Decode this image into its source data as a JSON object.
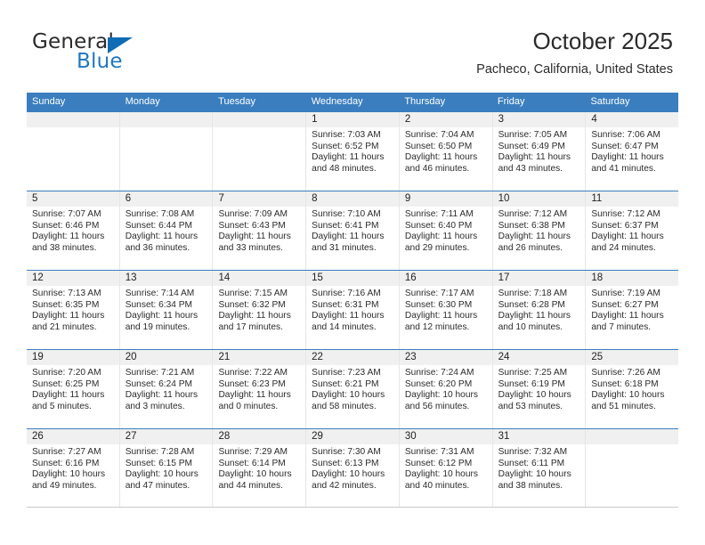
{
  "brand": {
    "name_top": "General",
    "name_bottom": "Blue",
    "accent_color": "#0f6cb5"
  },
  "header": {
    "title": "October 2025",
    "subtitle": "Pacheco, California, United States"
  },
  "calendar": {
    "header_color": "#3a7ebf",
    "weekdays": [
      "Sunday",
      "Monday",
      "Tuesday",
      "Wednesday",
      "Thursday",
      "Friday",
      "Saturday"
    ],
    "labels": {
      "sunrise": "Sunrise:",
      "sunset": "Sunset:",
      "daylight": "Daylight:"
    },
    "weeks": [
      [
        {
          "date": "",
          "empty": true
        },
        {
          "date": "",
          "empty": true
        },
        {
          "date": "",
          "empty": true
        },
        {
          "date": "1",
          "sunrise": "Sunrise: 7:03 AM",
          "sunset": "Sunset: 6:52 PM",
          "daylight": "Daylight: 11 hours and 48 minutes."
        },
        {
          "date": "2",
          "sunrise": "Sunrise: 7:04 AM",
          "sunset": "Sunset: 6:50 PM",
          "daylight": "Daylight: 11 hours and 46 minutes."
        },
        {
          "date": "3",
          "sunrise": "Sunrise: 7:05 AM",
          "sunset": "Sunset: 6:49 PM",
          "daylight": "Daylight: 11 hours and 43 minutes."
        },
        {
          "date": "4",
          "sunrise": "Sunrise: 7:06 AM",
          "sunset": "Sunset: 6:47 PM",
          "daylight": "Daylight: 11 hours and 41 minutes."
        }
      ],
      [
        {
          "date": "5",
          "sunrise": "Sunrise: 7:07 AM",
          "sunset": "Sunset: 6:46 PM",
          "daylight": "Daylight: 11 hours and 38 minutes."
        },
        {
          "date": "6",
          "sunrise": "Sunrise: 7:08 AM",
          "sunset": "Sunset: 6:44 PM",
          "daylight": "Daylight: 11 hours and 36 minutes."
        },
        {
          "date": "7",
          "sunrise": "Sunrise: 7:09 AM",
          "sunset": "Sunset: 6:43 PM",
          "daylight": "Daylight: 11 hours and 33 minutes."
        },
        {
          "date": "8",
          "sunrise": "Sunrise: 7:10 AM",
          "sunset": "Sunset: 6:41 PM",
          "daylight": "Daylight: 11 hours and 31 minutes."
        },
        {
          "date": "9",
          "sunrise": "Sunrise: 7:11 AM",
          "sunset": "Sunset: 6:40 PM",
          "daylight": "Daylight: 11 hours and 29 minutes."
        },
        {
          "date": "10",
          "sunrise": "Sunrise: 7:12 AM",
          "sunset": "Sunset: 6:38 PM",
          "daylight": "Daylight: 11 hours and 26 minutes."
        },
        {
          "date": "11",
          "sunrise": "Sunrise: 7:12 AM",
          "sunset": "Sunset: 6:37 PM",
          "daylight": "Daylight: 11 hours and 24 minutes."
        }
      ],
      [
        {
          "date": "12",
          "sunrise": "Sunrise: 7:13 AM",
          "sunset": "Sunset: 6:35 PM",
          "daylight": "Daylight: 11 hours and 21 minutes."
        },
        {
          "date": "13",
          "sunrise": "Sunrise: 7:14 AM",
          "sunset": "Sunset: 6:34 PM",
          "daylight": "Daylight: 11 hours and 19 minutes."
        },
        {
          "date": "14",
          "sunrise": "Sunrise: 7:15 AM",
          "sunset": "Sunset: 6:32 PM",
          "daylight": "Daylight: 11 hours and 17 minutes."
        },
        {
          "date": "15",
          "sunrise": "Sunrise: 7:16 AM",
          "sunset": "Sunset: 6:31 PM",
          "daylight": "Daylight: 11 hours and 14 minutes."
        },
        {
          "date": "16",
          "sunrise": "Sunrise: 7:17 AM",
          "sunset": "Sunset: 6:30 PM",
          "daylight": "Daylight: 11 hours and 12 minutes."
        },
        {
          "date": "17",
          "sunrise": "Sunrise: 7:18 AM",
          "sunset": "Sunset: 6:28 PM",
          "daylight": "Daylight: 11 hours and 10 minutes."
        },
        {
          "date": "18",
          "sunrise": "Sunrise: 7:19 AM",
          "sunset": "Sunset: 6:27 PM",
          "daylight": "Daylight: 11 hours and 7 minutes."
        }
      ],
      [
        {
          "date": "19",
          "sunrise": "Sunrise: 7:20 AM",
          "sunset": "Sunset: 6:25 PM",
          "daylight": "Daylight: 11 hours and 5 minutes."
        },
        {
          "date": "20",
          "sunrise": "Sunrise: 7:21 AM",
          "sunset": "Sunset: 6:24 PM",
          "daylight": "Daylight: 11 hours and 3 minutes."
        },
        {
          "date": "21",
          "sunrise": "Sunrise: 7:22 AM",
          "sunset": "Sunset: 6:23 PM",
          "daylight": "Daylight: 11 hours and 0 minutes."
        },
        {
          "date": "22",
          "sunrise": "Sunrise: 7:23 AM",
          "sunset": "Sunset: 6:21 PM",
          "daylight": "Daylight: 10 hours and 58 minutes."
        },
        {
          "date": "23",
          "sunrise": "Sunrise: 7:24 AM",
          "sunset": "Sunset: 6:20 PM",
          "daylight": "Daylight: 10 hours and 56 minutes."
        },
        {
          "date": "24",
          "sunrise": "Sunrise: 7:25 AM",
          "sunset": "Sunset: 6:19 PM",
          "daylight": "Daylight: 10 hours and 53 minutes."
        },
        {
          "date": "25",
          "sunrise": "Sunrise: 7:26 AM",
          "sunset": "Sunset: 6:18 PM",
          "daylight": "Daylight: 10 hours and 51 minutes."
        }
      ],
      [
        {
          "date": "26",
          "sunrise": "Sunrise: 7:27 AM",
          "sunset": "Sunset: 6:16 PM",
          "daylight": "Daylight: 10 hours and 49 minutes."
        },
        {
          "date": "27",
          "sunrise": "Sunrise: 7:28 AM",
          "sunset": "Sunset: 6:15 PM",
          "daylight": "Daylight: 10 hours and 47 minutes."
        },
        {
          "date": "28",
          "sunrise": "Sunrise: 7:29 AM",
          "sunset": "Sunset: 6:14 PM",
          "daylight": "Daylight: 10 hours and 44 minutes."
        },
        {
          "date": "29",
          "sunrise": "Sunrise: 7:30 AM",
          "sunset": "Sunset: 6:13 PM",
          "daylight": "Daylight: 10 hours and 42 minutes."
        },
        {
          "date": "30",
          "sunrise": "Sunrise: 7:31 AM",
          "sunset": "Sunset: 6:12 PM",
          "daylight": "Daylight: 10 hours and 40 minutes."
        },
        {
          "date": "31",
          "sunrise": "Sunrise: 7:32 AM",
          "sunset": "Sunset: 6:11 PM",
          "daylight": "Daylight: 10 hours and 38 minutes."
        },
        {
          "date": "",
          "empty": true
        }
      ]
    ]
  }
}
